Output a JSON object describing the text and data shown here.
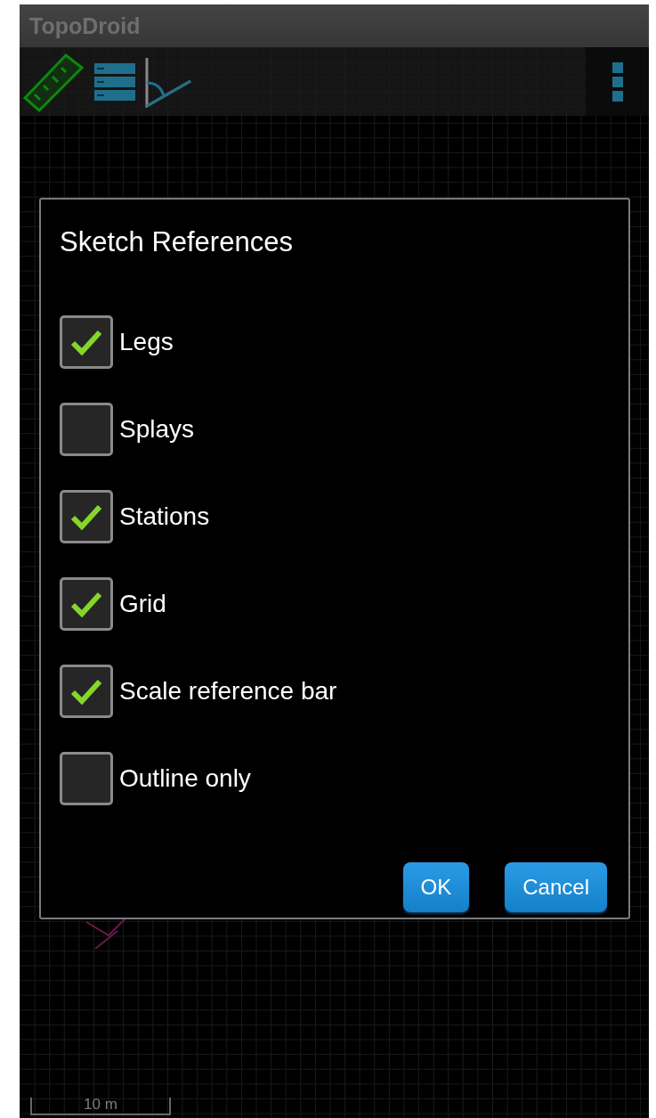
{
  "app_bar": {
    "title": "TopoDroid"
  },
  "dialog": {
    "title": "Sketch References",
    "options": [
      {
        "label": "Legs",
        "checked": true
      },
      {
        "label": "Splays",
        "checked": false
      },
      {
        "label": "Stations",
        "checked": true
      },
      {
        "label": "Grid",
        "checked": true
      },
      {
        "label": "Scale reference bar",
        "checked": true
      },
      {
        "label": "Outline only",
        "checked": false
      }
    ],
    "buttons": [
      {
        "label": "OK"
      },
      {
        "label": "Cancel"
      }
    ]
  },
  "scale_bar": {
    "label": "10 m"
  }
}
